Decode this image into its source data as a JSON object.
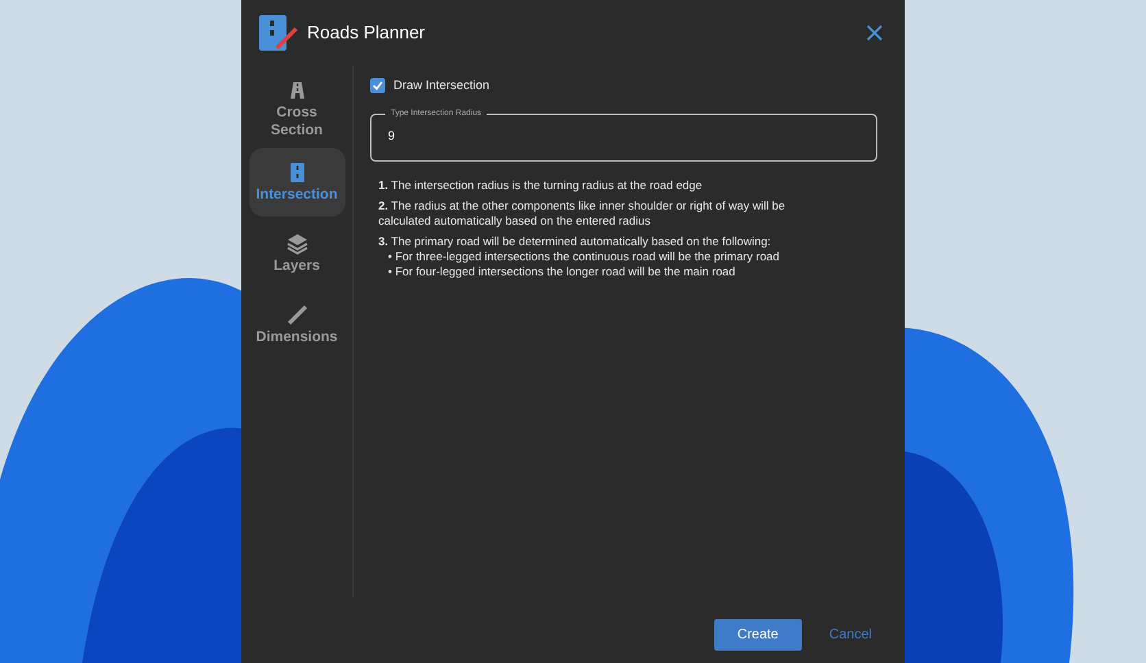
{
  "window": {
    "title": "Roads Planner"
  },
  "sidebar": {
    "items": [
      {
        "kind": "cross-section",
        "label": "Cross Section",
        "selected": false
      },
      {
        "kind": "intersection",
        "label": "Intersection",
        "selected": true
      },
      {
        "kind": "layers",
        "label": "Layers",
        "selected": false
      },
      {
        "kind": "dimensions",
        "label": "Dimensions",
        "selected": false
      }
    ]
  },
  "draw_intersection": {
    "label": "Draw Intersection",
    "checked": true
  },
  "radius_field": {
    "label": "Type Intersection Radius",
    "value": "9"
  },
  "notes": [
    {
      "text": "**1.** The intersection radius is the turning radius at the road edge"
    },
    {
      "text": "**2.** The radius at the other components like inner shoulder or right of way will be calculated automatically based on the entered radius"
    },
    {
      "text": "**3.** The primary road will be determined automatically based on the following:",
      "bullets": [
        "• For three-legged intersections the continuous road will be the primary road",
        "• For four-legged intersections the longer road will be the main road"
      ]
    }
  ],
  "buttons": {
    "create": "Create",
    "cancel": "Cancel"
  }
}
